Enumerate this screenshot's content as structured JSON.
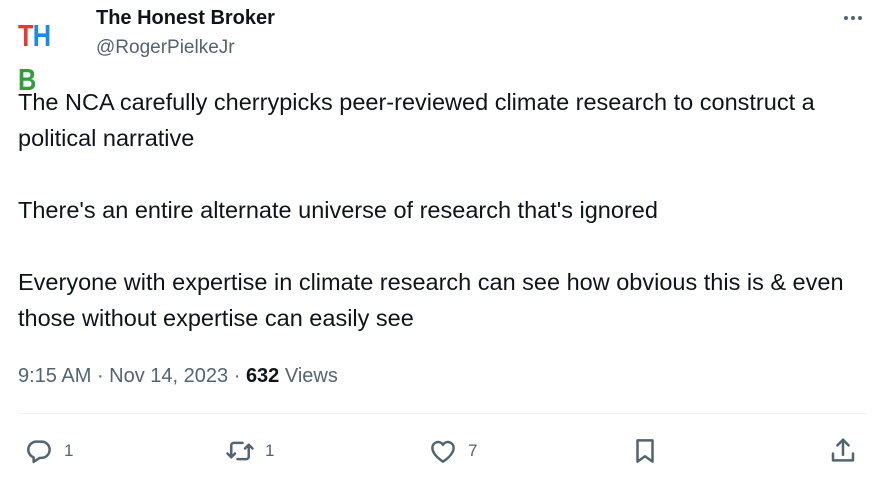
{
  "author": {
    "avatar_letters": [
      "T",
      "H",
      "B"
    ],
    "avatar_colors": [
      "#e53935",
      "#1e88e5",
      "#2e9e3e"
    ],
    "name": "The Honest Broker",
    "handle": "@RogerPielkeJr"
  },
  "tweet": {
    "paragraphs": [
      "The NCA carefully cherrypicks peer-reviewed climate research to construct a political narrative",
      "There's an entire alternate universe of research that's ignored",
      "Everyone with expertise in climate research can see how obvious this is & even those without expertise can easily see"
    ],
    "time": "9:15 AM",
    "separator": " · ",
    "date": "Nov 14, 2023",
    "views_count": "632",
    "views_label": "Views"
  },
  "actions": {
    "reply_count": "1",
    "repost_count": "1",
    "like_count": "7"
  },
  "icons": {
    "more": "more-icon",
    "reply": "reply-icon",
    "repost": "repost-icon",
    "like": "heart-icon",
    "bookmark": "bookmark-icon",
    "share": "share-icon"
  }
}
